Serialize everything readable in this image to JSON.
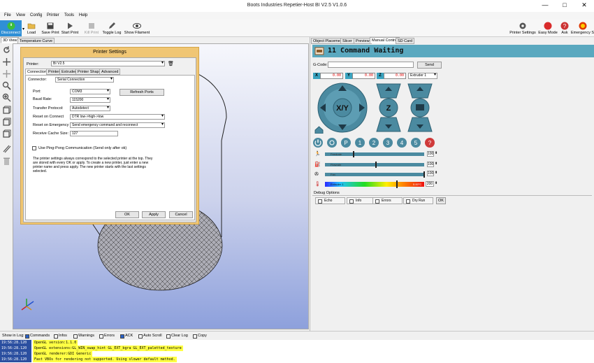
{
  "window": {
    "title": "Boots Industries Repetier-Host BI V2.5 V1.0.6",
    "minimize": "—",
    "maximize": "□",
    "close": "✕"
  },
  "menu": [
    "File",
    "View",
    "Config",
    "Printer",
    "Tools",
    "Help"
  ],
  "toolbar": {
    "left": [
      "Disconnect",
      "Load",
      "Save Print",
      "Start Print",
      "Kill Print",
      "Toggle Log",
      "Show Filament"
    ],
    "right": [
      "Printer Settings",
      "Easy Mode",
      "Ask",
      "Emergency Stop"
    ]
  },
  "left_tabs": [
    "3D View",
    "Temperature Curve"
  ],
  "dialog": {
    "title": "Printer Settings",
    "printer_label": "Printer:",
    "printer_value": "BI V2.5",
    "tabs": [
      "Connection",
      "Printer",
      "Extruder",
      "Printer Shape",
      "Advanced"
    ],
    "connector_label": "Connector:",
    "connector_value": "Serial Connection",
    "port_label": "Port:",
    "port_value": "COM3",
    "refresh_ports": "Refresh Ports",
    "baud_label": "Baud Rate:",
    "baud_value": "115200",
    "protocol_label": "Transfer Protocol:",
    "protocol_value": "Autodetect",
    "reset_connect_label": "Reset on Connect",
    "reset_connect_value": "DTR low->high->low",
    "reset_emergency_label": "Reset on Emergency",
    "reset_emergency_value": "Send emergency command and reconnect",
    "cache_label": "Receive Cache Size:",
    "cache_value": "127",
    "pingpong_label": "Use Ping-Pong Communication (Send only after ok)",
    "info_lines": [
      "The printer settings always correspond to the selected printer at the top. They",
      "are stored with every OK or apply. To create a new printer, just enter a new",
      "printer name and press apply. The new printer starts with the last settings",
      "selected."
    ],
    "ok": "OK",
    "apply": "Apply",
    "cancel": "Cancel"
  },
  "right_tabs": [
    "Object Placement",
    "Slicer",
    "Preview",
    "Manual Control",
    "SD Card"
  ],
  "control": {
    "command_status": "11 Command Waiting",
    "gcode_label": "G-Code:",
    "send": "Send",
    "x_label": "X",
    "x_value": "0.00",
    "y_label": "Y",
    "y_value": "0.00",
    "z_label": "Z",
    "z_value": "0.00",
    "extruder_select": "Extruder 1",
    "xy_label": "X/Y",
    "z_pad_label": "Z",
    "feedrate_label": "Feedrate",
    "feedrate_value": "100",
    "flowrate_label": "Flowrate",
    "flowrate_value": "100",
    "fan_label": "Fan",
    "fan_value": "100",
    "temp_label": "Extruder 1",
    "temp_value": "200",
    "temp_readout": "0.00°C",
    "temp_level": 0.72,
    "extruder_numbers": [
      "1",
      "2",
      "3",
      "4",
      "5"
    ],
    "p_label": "P",
    "help_label": "?",
    "debug_title": "Debug Options",
    "debug_options": [
      "Echo",
      "Info",
      "Errors",
      "Dry Run"
    ],
    "debug_ok": "OK"
  },
  "log": {
    "show_label": "Show in Log:",
    "options": [
      "Commands",
      "Infos",
      "Warnings",
      "Errors",
      "ACK",
      "Auto Scroll",
      "Clear Log",
      "Copy"
    ],
    "rows": [
      {
        "time": "19:56:28.120",
        "msg": "OpenGL version:1.1.0"
      },
      {
        "time": "19:56:28.120",
        "msg": "OpenGL extensions:GL_WIN_swap_hint GL_EXT_bgra GL_EXT_paletted_texture"
      },
      {
        "time": "19:56:28.120",
        "msg": "OpenGL renderer:GDI Generic"
      },
      {
        "time": "19:56:28.120",
        "msg": "Fast VBOs for rendering not supported. Using slower default method."
      }
    ]
  },
  "colors": {
    "accent": "#3aa3bf",
    "dial": "#4b8aa0",
    "dialog_border": "#f0c674",
    "log_highlight": "#ffff44"
  }
}
